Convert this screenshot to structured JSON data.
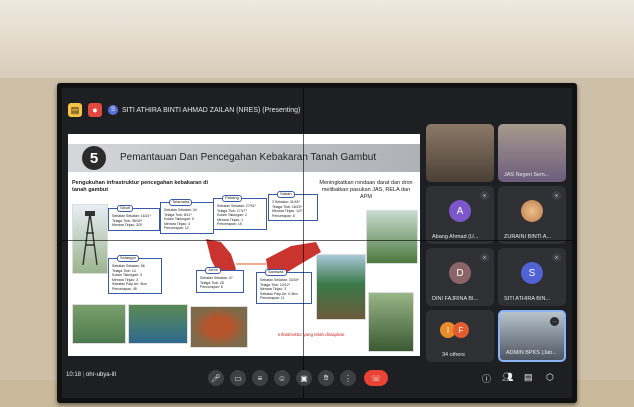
{
  "meeting": {
    "presenter": "SITI ATHIRA BINTI AHMAD ZAILAN (NRES) (Presenting)",
    "time": "10:18",
    "code": "ohr-ubya-itl",
    "presenter_initial": "S"
  },
  "slide": {
    "number": "5",
    "title": "Pemantauan Dan Pencegahan Kebakaran Tanah Gambut",
    "subtitle_left": "Pengukuhan infrastruktur pencegahan kebakaran di tanah gambut",
    "subtitle_right": "Meningkatkan rondaan darat dan dron melibatkan pasukan JAS, RELA dan APM",
    "legend": "Infrastruktur yang telah disiapkan.",
    "boxes": [
      {
        "tag": "Sibuti",
        "lines": [
          "Sebatan Sekatan: 16/21*",
          "Telaga Tiub: 38/43*",
          "Menara Tinjau: 3/3*"
        ]
      },
      {
        "tag": "Telamaha",
        "lines": [
          "Sebatan Sekatan: 34",
          "Telaga Tiub: 8/11*",
          "Kolam Takungan: 5",
          "Menara Tinjau: 4",
          "Pencerapan: 12"
        ]
      },
      {
        "tag": "Pahang",
        "lines": [
          "Sebatan Sekatan: 27/31*",
          "Telaga Tiub: 17/17*",
          "Kolam Takungan: 2",
          "Menara Tinjau: 1",
          "Pencerapan: 15"
        ]
      },
      {
        "tag": "Sabah",
        "lines": [
          "3 Sekatan: 41/43*",
          "Telaga Tiub: 18/23*",
          "Menara Tinjau: 1/2*",
          "Pencerapan: 8"
        ]
      },
      {
        "tag": "Selangor",
        "lines": [
          "Sebatan Sekatan: 56",
          "Telaga Tiub: 14",
          "Kolam Takungan: 3",
          "Menara Tinjau: 3",
          "Sebatan Paip Air: 3km",
          "Pencerapan: 48"
        ]
      },
      {
        "tag": "Johor",
        "lines": [
          "Sebatan Sekatan: 47",
          "Telaga Tiub: 28",
          "Pencerapan: 6"
        ]
      },
      {
        "tag": "Sarawak",
        "lines": [
          "Sebatan Sekatan: 33/34*",
          "Telaga Tiub: 10/12*",
          "Menara Tinjau: 3",
          "Sebatan Paip Air: 0.3km",
          "Pencerapan: 11"
        ]
      }
    ]
  },
  "participants": [
    {
      "name": "",
      "type": "video"
    },
    {
      "name": "JAS Negeri Sem...",
      "type": "video"
    },
    {
      "name": "Abang Ahmad (U...",
      "initial": "A",
      "color": "#7b57c9"
    },
    {
      "name": "ZURAINI BINTI A...",
      "type": "photo"
    },
    {
      "name": "DINI FAJRINA BI...",
      "initial": "D",
      "color": "#8a6468"
    },
    {
      "name": "SITI ATHIRA BIN...",
      "initial": "S",
      "color": "#5161d6"
    },
    {
      "name": "34 others",
      "initials": [
        "I",
        "F"
      ],
      "colors": [
        "#e98b2a",
        "#e25c2f"
      ]
    },
    {
      "name": "ADMIN BPKS (Jab...",
      "type": "video"
    }
  ],
  "controls": [
    "mic-off",
    "camera-off",
    "captions",
    "emoji",
    "present",
    "raise-hand",
    "more",
    "end-call"
  ],
  "side_controls": [
    "info",
    "people",
    "chat",
    "activities"
  ],
  "colors": {
    "accent": "#5161d6",
    "end": "#ea4335",
    "slide_box": "#3a5aa8"
  }
}
